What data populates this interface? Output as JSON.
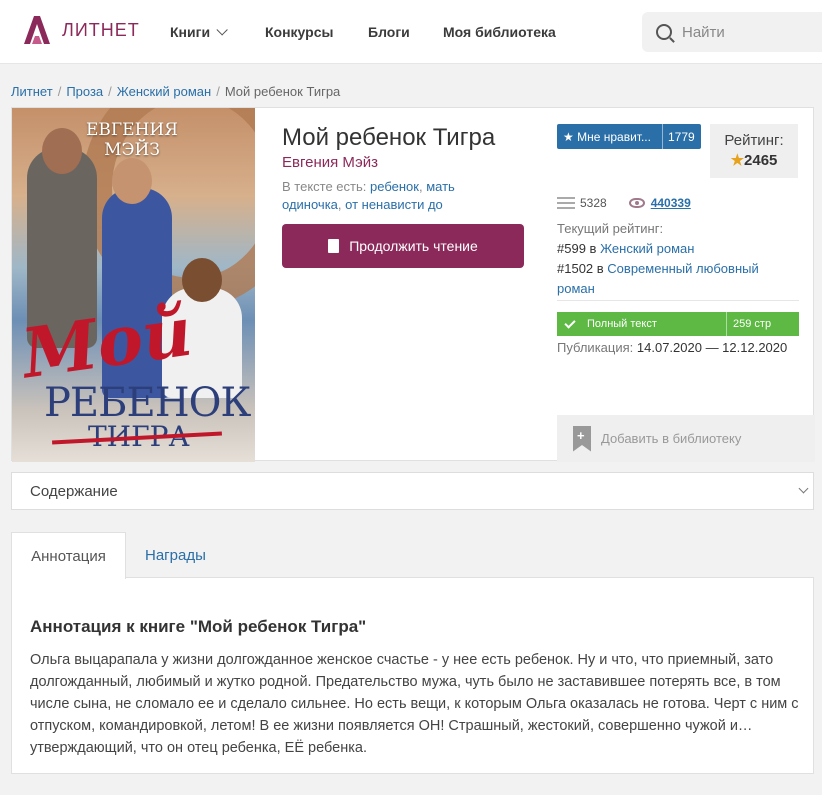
{
  "header": {
    "logo_text": "ЛИТНЕТ",
    "nav": {
      "books": "Книги",
      "contests": "Конкурсы",
      "blogs": "Блоги",
      "library": "Моя библиотека"
    },
    "search_placeholder": "Найти"
  },
  "breadcrumb": [
    "Литнет",
    "Проза",
    "Женский роман",
    "Мой ребенок Тигра"
  ],
  "book": {
    "cover": {
      "author": "ЕВГЕНИЯ МЭЙЗ",
      "title_line1": "Мой",
      "title_line2": "РЕБЕНОК",
      "title_line3": "ТИГРА"
    },
    "title": "Мой ребенок Тигра",
    "author": "Евгения Мэйз",
    "tags_label": "В тексте есть:",
    "tags": [
      "ребенок",
      "мать одиночка",
      "от ненависти до"
    ],
    "read_button": "Продолжить чтение",
    "like_label": "★ Мне нравит...",
    "like_count": "1779",
    "rating_label": "Рейтинг:",
    "rating_value": "2465",
    "library_count": "5328",
    "views": "440339",
    "current_rating_label": "Текущий рейтинг:",
    "rank1_num": "#599 в",
    "rank1_genre": "Женский роман",
    "rank2_num": "#1502 в",
    "rank2_genre": "Современный любовный роман",
    "full_text_label": "Полный текст",
    "pages": "259 стр",
    "publication_label": "Публикация:",
    "publication_dates": "14.07.2020 — 12.12.2020",
    "add_to_library": "Добавить в библиотеку"
  },
  "contents_select": "Содержание",
  "tabs": {
    "annotation": "Аннотация",
    "awards": "Награды"
  },
  "annotation": {
    "title": "Аннотация к книге \"Мой ребенок Тигра\"",
    "text": "Ольга выцарапала у жизни долгожданное женское счастье - у нее есть ребенок. Ну и что, что приемный, зато долгожданный, любимый и жутко родной. Предательство мужа, чуть было не заставившее потерять все, в том числе сына, не сломало ее и сделало сильнее. Но есть вещи, к которым Ольга оказалась не готова. Черт с ним с отпуском, командировкой, летом! В ее жизни появляется ОН! Страшный, жестокий, совершенно чужой и… утверждающий, что он отец ребенка, ЕЁ ребенка."
  },
  "colors": {
    "brand": "#8b2a5a",
    "link": "#2a6fa8",
    "like_button": "#2a6fa8",
    "full_text_bar": "#5db844",
    "star": "#e7a21e"
  }
}
